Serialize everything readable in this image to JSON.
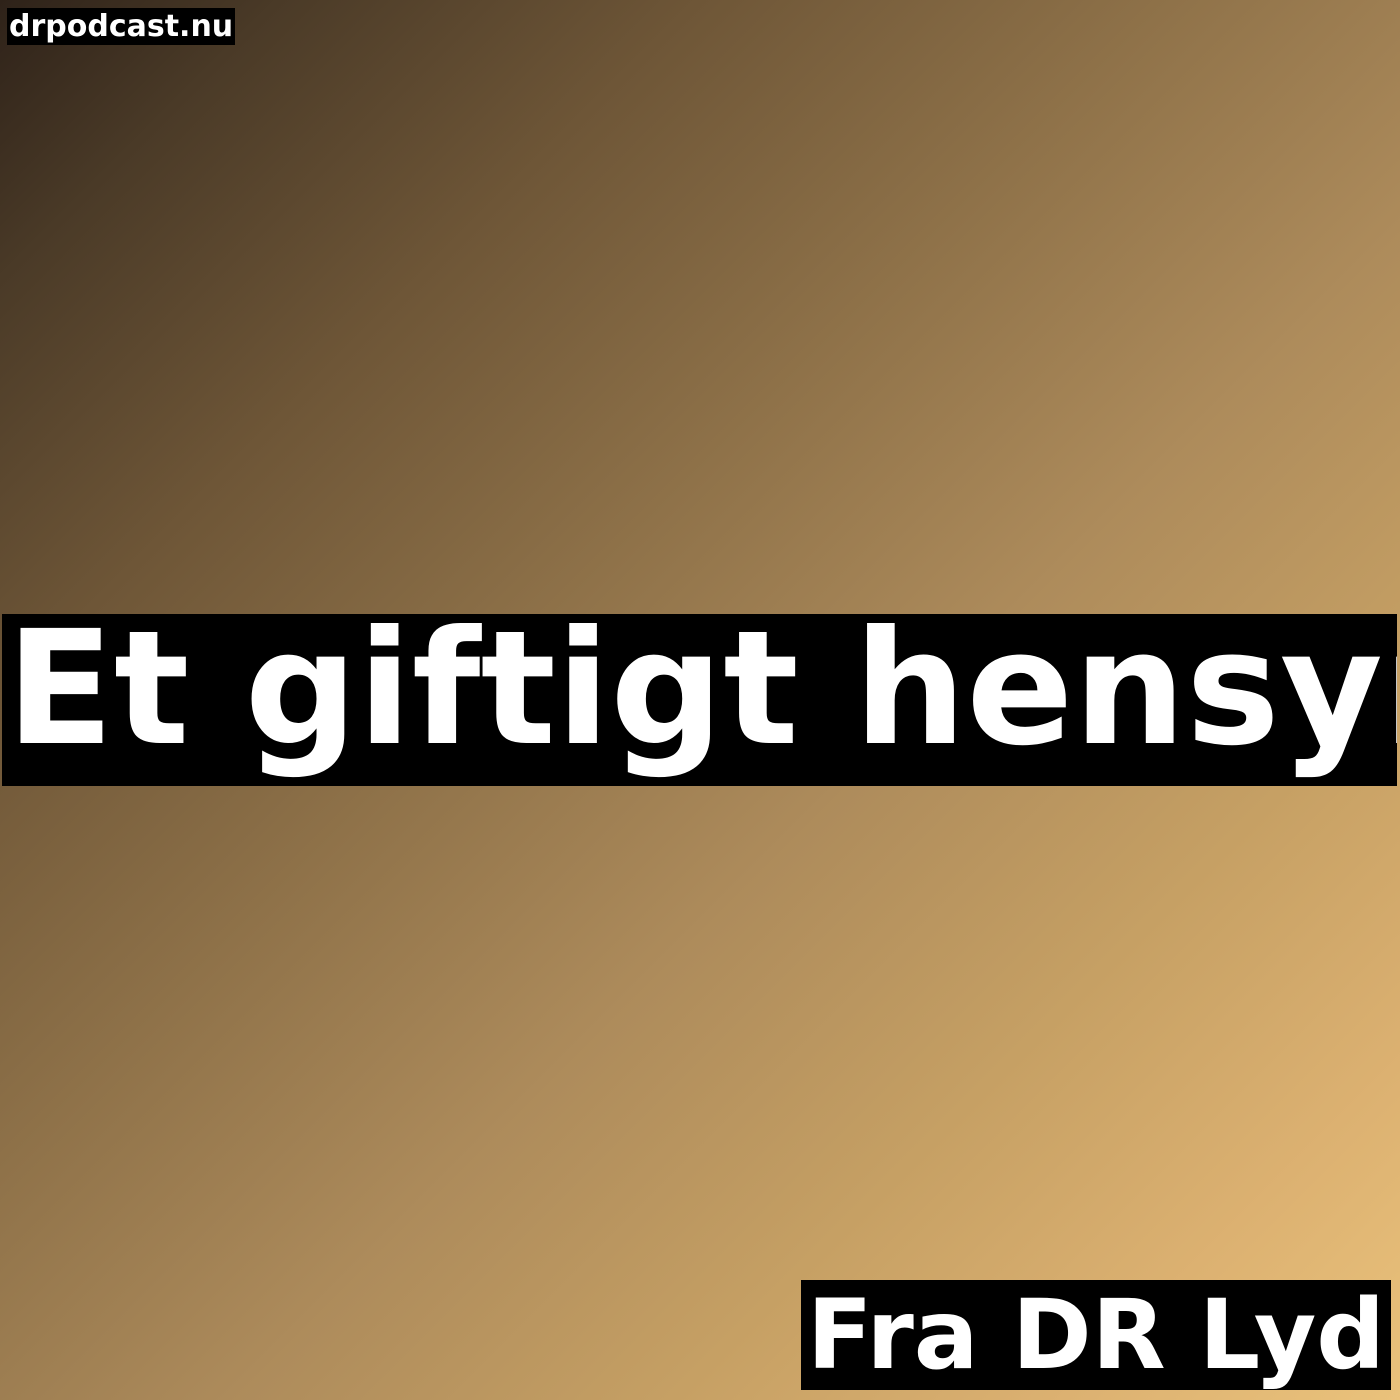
{
  "cover": {
    "site_label": "drpodcast.nu",
    "title": "Et giftigt hensyn",
    "source": "Fra DR Lyd"
  },
  "colors": {
    "gradient_start": "#2e2219",
    "gradient_end": "#eac27b",
    "label_background": "#000000",
    "label_text": "#ffffff"
  }
}
